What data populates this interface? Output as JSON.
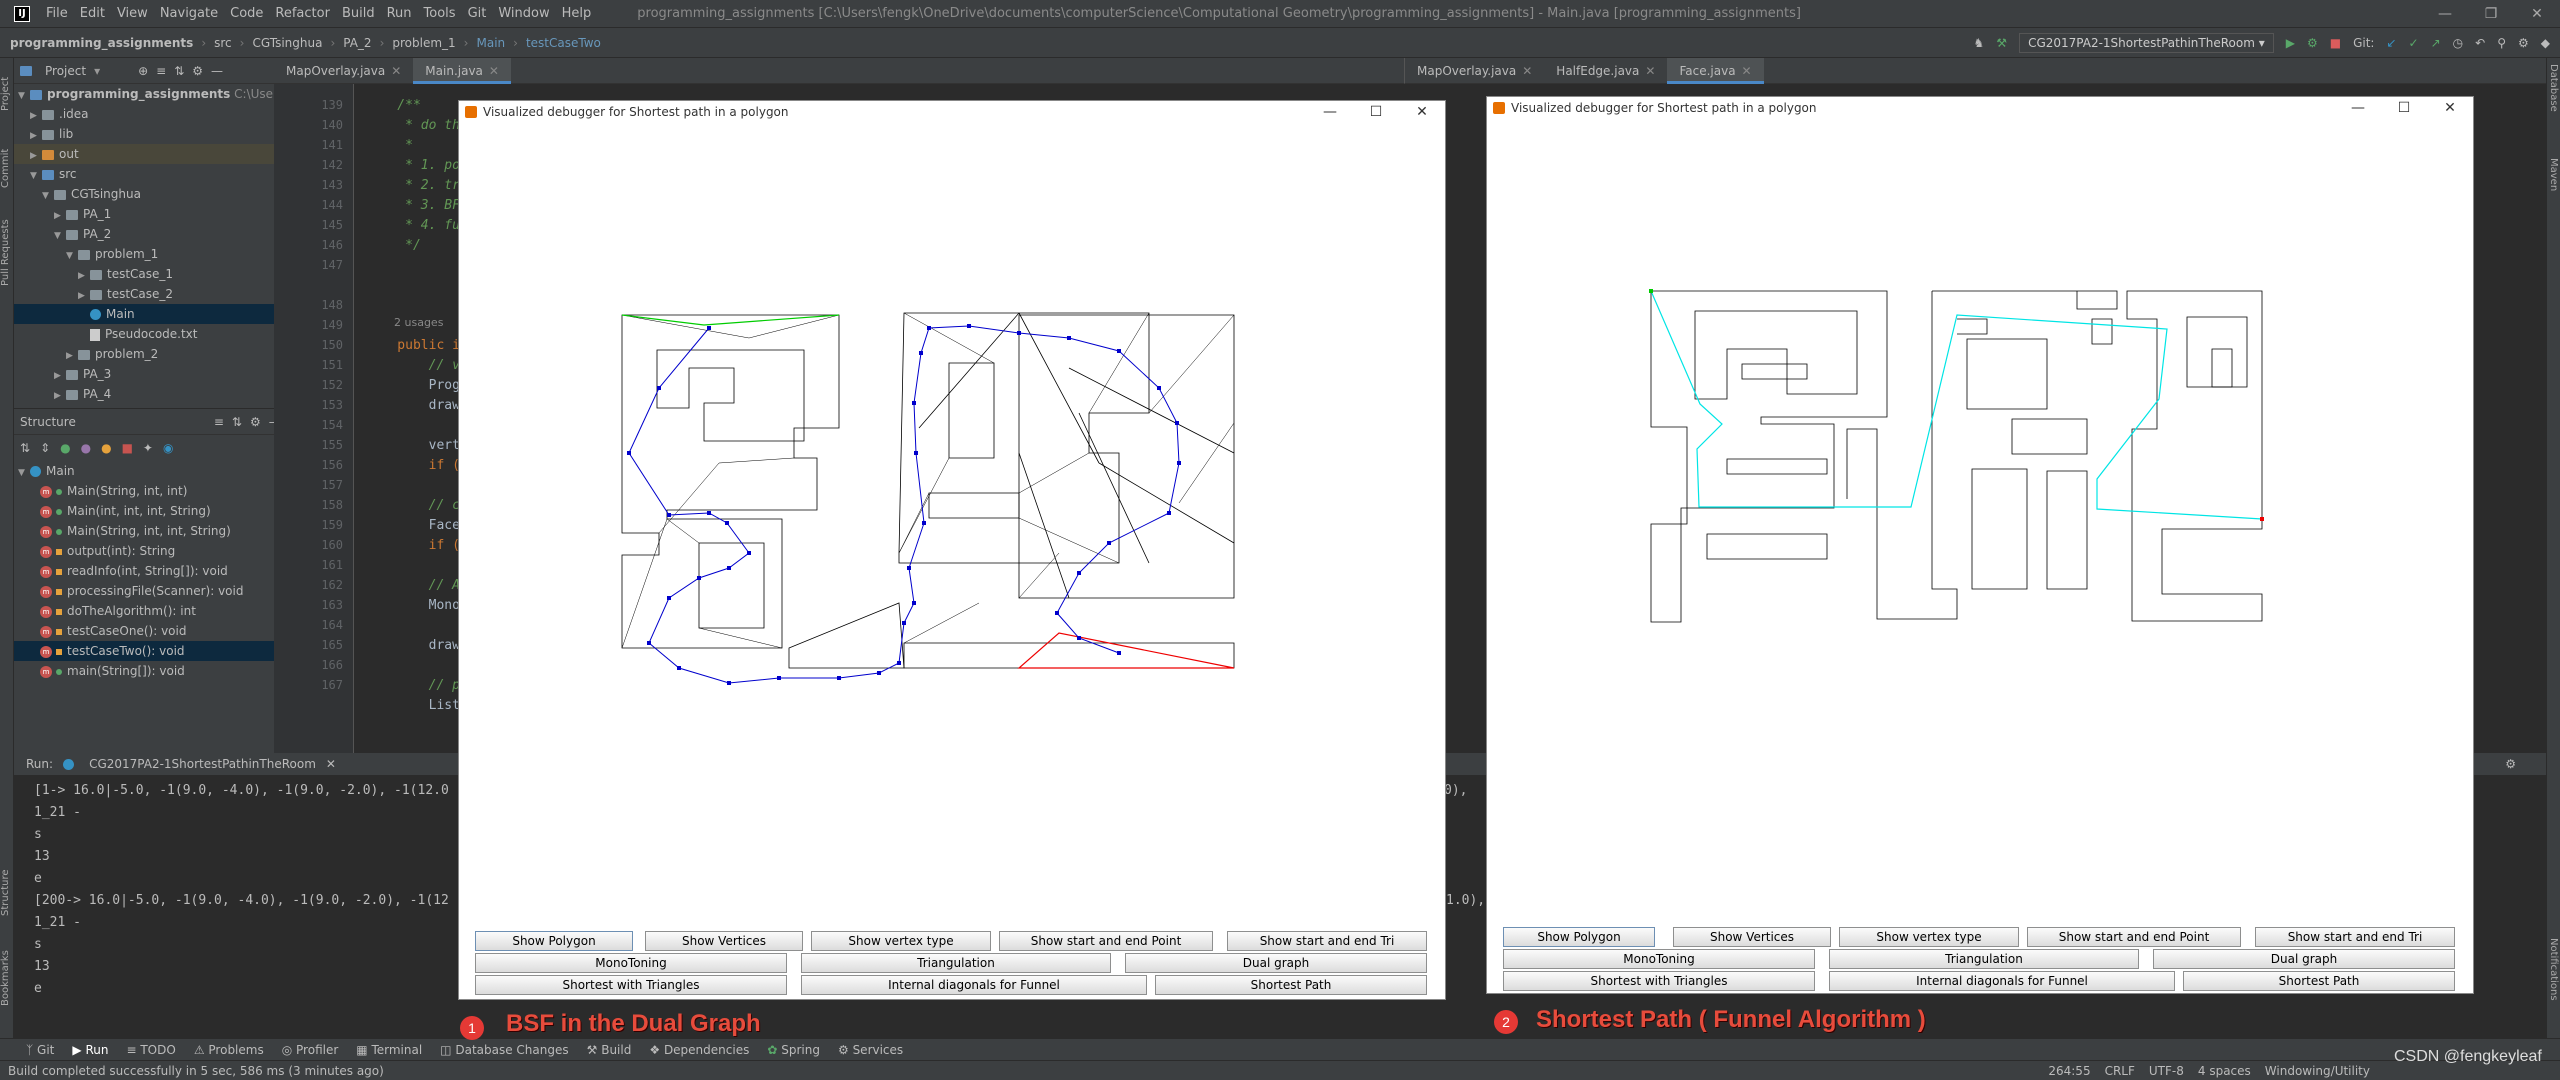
{
  "menubar": {
    "items": [
      "File",
      "Edit",
      "View",
      "Navigate",
      "Code",
      "Refactor",
      "Build",
      "Run",
      "Tools",
      "Git",
      "Window",
      "Help"
    ],
    "window_title": "programming_assignments [C:\\Users\\fengk\\OneDrive\\documents\\computerScience\\Computational Geometry\\programming_assignments] - Main.java [programming_assignments]"
  },
  "navbar": {
    "crumbs": [
      "programming_assignments",
      "src",
      "CGTsinghua",
      "PA_2",
      "problem_1",
      "Main",
      "testCaseTwo"
    ],
    "run_config": "CG2017PA2-1ShortestPathinTheRoom",
    "git_label": "Git:"
  },
  "leftstrip": {
    "labels": [
      "Project",
      "Commit",
      "Pull Requests",
      "Structure",
      "Bookmarks"
    ]
  },
  "rightstrip": {
    "labels": [
      "Database",
      "Maven",
      "Notifications"
    ]
  },
  "project": {
    "header": "Project",
    "root": "programming_assignments",
    "root_path": "C:\\Users\\f",
    "items": [
      ".idea",
      "lib",
      "out",
      "src",
      "CGTsinghua",
      "PA_1",
      "PA_2",
      "problem_1",
      "testCase_1",
      "testCase_2",
      "Main",
      "Pseudocode.txt",
      "problem_2",
      "PA_3",
      "PA_4"
    ]
  },
  "structure": {
    "header": "Structure",
    "root": "Main",
    "members": [
      "Main(String, int, int)",
      "Main(int, int, int, String)",
      "Main(String, int, int, String)",
      "output(int): String",
      "readInfo(int, String[]): void",
      "processingFile(Scanner): void",
      "doTheAlgorithm(): int",
      "testCaseOne(): void",
      "testCaseTwo(): void",
      "main(String[]): void"
    ]
  },
  "editor": {
    "tabs_left": [
      "MapOverlay.java",
      "Main.java"
    ],
    "tabs_right": [
      "MapOverlay.java",
      "HalfEdge.java",
      "Face.java"
    ],
    "line_numbers": [
      "139",
      "140",
      "141",
      "142",
      "143",
      "144",
      "145",
      "146",
      "147",
      "148",
      "149",
      "150",
      "151",
      "152",
      "153",
      "154",
      "155",
      "156",
      "157",
      "158",
      "159",
      "160",
      "161",
      "162",
      "163",
      "164",
      "165",
      "166",
      "167"
    ],
    "usages": "2 usages",
    "code": {
      "l139": "    /**",
      "l140": "     * do th",
      "l141": "     *",
      "l142": "     * 1. po",
      "l143": "     * 2. tr",
      "l144": "     * 3. BF",
      "l145": "     * 4. fu",
      "l146": "     */",
      "l149": "    public i",
      "l150": "        // v",
      "l151": "        Progr",
      "l152": "        draw",
      "l154": "        vert",
      "l155": "        if (",
      "l157": "        // c",
      "l158": "        Face",
      "l159": "        if (",
      "l161": "        // A",
      "l162": "        Mono",
      "l164": "        draw",
      "l166": "        // p",
      "l167": "        List"
    }
  },
  "run": {
    "label": "Run:",
    "config": "CG2017PA2-1ShortestPathinTheRoom",
    "lines": [
      "[1-> 16.0|-5.0, -1(9.0, -4.0), -1(9.0, -2.0), -1(12.0",
      "1_21 -",
      "s",
      "13",
      "e",
      "",
      "[200-> 16.0|-5.0, -1(9.0, -4.0), -1(9.0, -2.0), -1(12",
      "1_21 -",
      "s",
      "13",
      "e"
    ],
    "tail1": "0),",
    "tail2": "1.0),"
  },
  "bottom_tools": [
    "Git",
    "Run",
    "TODO",
    "Problems",
    "Profiler",
    "Terminal",
    "Database Changes",
    "Build",
    "Dependencies",
    "Spring",
    "Services"
  ],
  "status": {
    "message": "Build completed successfully in 5 sec, 586 ms (3 minutes ago)",
    "position": "264:55",
    "line_sep": "CRLF",
    "encoding": "UTF-8",
    "indent": "4 spaces",
    "extra": "Windowing/Utility"
  },
  "window1": {
    "title": "Visualized debugger for Shortest path in a polygon",
    "buttons_row1": [
      "Show Polygon",
      "Show Vertices",
      "Show vertex type",
      "Show start and end Point",
      "Show start and end Tri"
    ],
    "buttons_row2": [
      "MonoToning",
      "Triangulation",
      "Dual graph"
    ],
    "buttons_row3": [
      "Shortest with Triangles",
      "Internal diagonals for Funnel",
      "Shortest Path"
    ]
  },
  "window2": {
    "title": "Visualized debugger for Shortest path in a polygon",
    "buttons_row1": [
      "Show Polygon",
      "Show Vertices",
      "Show vertex type",
      "Show start and end Point",
      "Show start and end Tri"
    ],
    "buttons_row2": [
      "MonoToning",
      "Triangulation",
      "Dual graph"
    ],
    "buttons_row3": [
      "Shortest with Triangles",
      "Internal diagonals for Funnel",
      "Shortest Path"
    ]
  },
  "captions": {
    "badge1": "1",
    "caption1": "BSF in the Dual Graph",
    "badge2": "2",
    "caption2": "Shortest Path ( Funnel Algorithm )",
    "watermark": "CSDN @fengkeyleaf"
  },
  "colors": {
    "polygon": "#000000",
    "dual_graph": "#0000cc",
    "start_tri": "#00cc00",
    "end_tri": "#ee0000",
    "funnel_path": "#00e5e5",
    "caption": "#e74c3c"
  }
}
